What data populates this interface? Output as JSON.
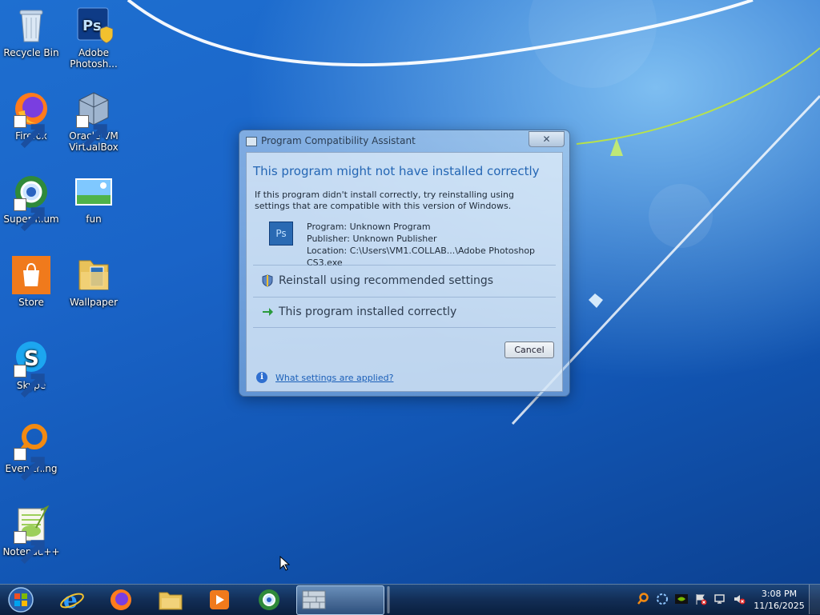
{
  "desktop": {
    "icons": [
      {
        "label": "Recycle Bin",
        "icon": "recycle-bin-icon"
      },
      {
        "label": "Adobe Photosh...",
        "icon": "photoshop-icon"
      },
      {
        "label": "Firefox",
        "icon": "firefox-icon"
      },
      {
        "label": "Oracle VM VirtualBox",
        "icon": "virtualbox-icon"
      },
      {
        "label": "Supermium",
        "icon": "supermium-icon"
      },
      {
        "label": "fun",
        "icon": "image-file-icon"
      },
      {
        "label": "Store",
        "icon": "store-icon"
      },
      {
        "label": "Wallpaper",
        "icon": "folder-icon"
      },
      {
        "label": "Skype",
        "icon": "skype-icon"
      },
      {
        "label": "Everything",
        "icon": "everything-search-icon"
      },
      {
        "label": "Notepad++",
        "icon": "notepadpp-icon"
      }
    ]
  },
  "dialog": {
    "title": "Program Compatibility Assistant",
    "close_label": "✕",
    "headline": "This program might not have installed correctly",
    "description": "If this program didn't install correctly, try reinstalling using settings that are compatible with this version of Windows.",
    "program_icon_text": "Ps",
    "program": "Program: Unknown Program",
    "publisher": "Publisher: Unknown Publisher",
    "location": "Location: C:\\Users\\VM1.COLLAB...\\Adobe Photoshop CS3.exe",
    "option_reinstall": "Reinstall using recommended settings",
    "option_installed": "This program installed correctly",
    "cancel_label": "Cancel",
    "help_link": "What settings are applied?"
  },
  "taskbar": {
    "pinned": [
      "start-orb",
      "internet-explorer-icon",
      "firefox-icon",
      "file-explorer-icon",
      "media-player-icon",
      "supermium-icon"
    ],
    "active_window": "Program Compatibility Assistant",
    "tray_icons": [
      "search-tray-icon",
      "sync-tray-icon",
      "nvidia-tray-icon",
      "flag-tray-icon",
      "network-tray-icon",
      "volume-muted-icon"
    ],
    "clock_time": "3:08 PM",
    "clock_date": "11/16/2025"
  },
  "colors": {
    "desktop_blue": "#1a64c8",
    "headline_blue": "#2466b4",
    "link_blue": "#1a5fb8"
  }
}
